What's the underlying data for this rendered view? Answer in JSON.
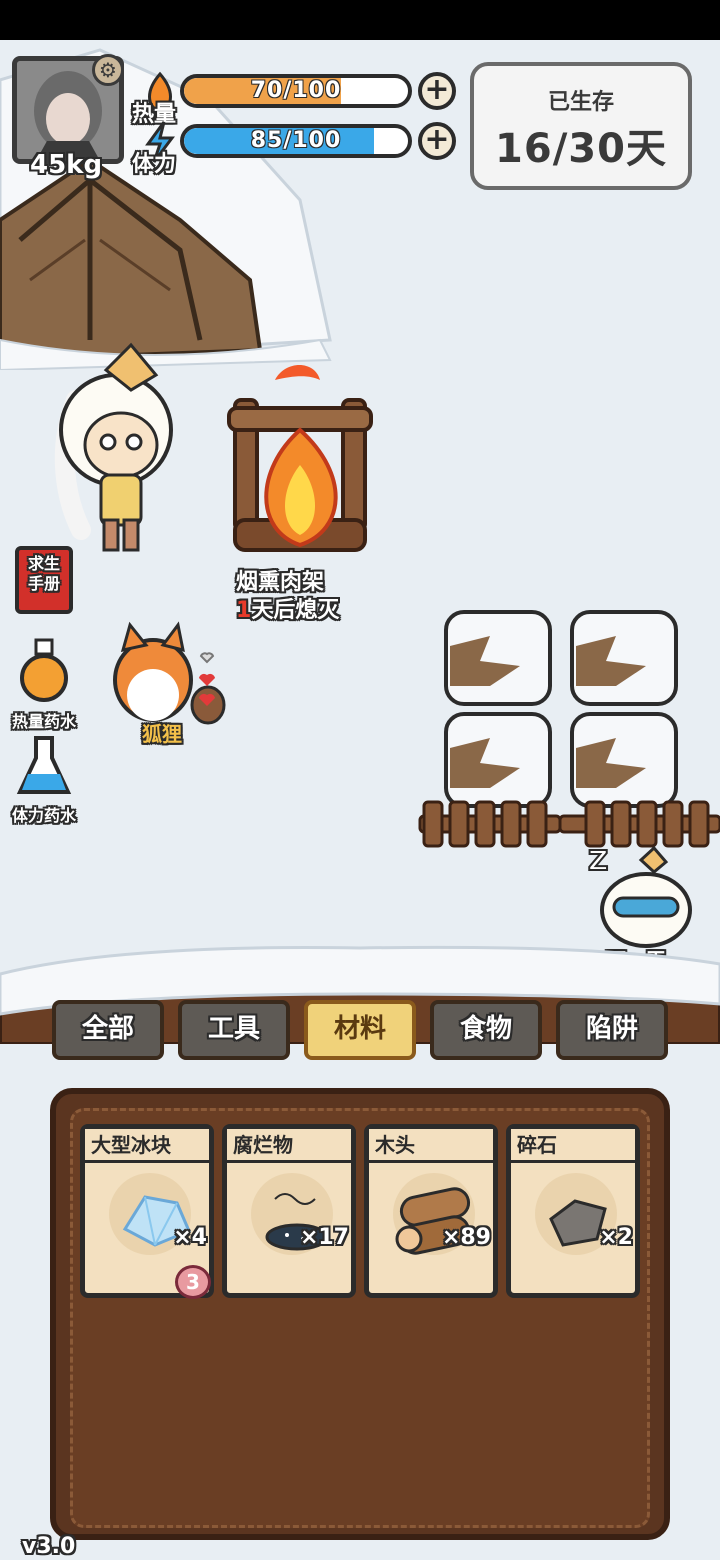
{
  "hud": {
    "weight": "45kg",
    "heat": {
      "label": "热量",
      "value": "70/100",
      "ratio": 0.7,
      "color": "#f0a24a"
    },
    "stamina": {
      "label": "体力",
      "value": "85/100",
      "ratio": 0.85,
      "color": "#3aa8e8"
    },
    "survived": {
      "label": "已生存",
      "value": "16/30天"
    }
  },
  "side": {
    "handbook": "求生\n手册",
    "handbook_line1": "求生",
    "handbook_line2": "手册",
    "heat_potion": "热量药水",
    "stamina_potion": "体力药水"
  },
  "world": {
    "campfire_name": "烟熏肉架",
    "campfire_days": "1",
    "campfire_status": "天后熄灭",
    "pet_name": "狐狸",
    "next_day": "下一天",
    "sleep_mark": "ZZZ"
  },
  "tabs": [
    {
      "label": "全部",
      "active": false
    },
    {
      "label": "工具",
      "active": false
    },
    {
      "label": "材料",
      "active": true
    },
    {
      "label": "食物",
      "active": false
    },
    {
      "label": "陷阱",
      "active": false
    }
  ],
  "inventory": [
    {
      "name": "大型冰块",
      "count": "×4",
      "badge": "3",
      "icon": "ice-block-icon"
    },
    {
      "name": "腐烂物",
      "count": "×17",
      "badge": "",
      "icon": "rotten-food-icon"
    },
    {
      "name": "木头",
      "count": "×89",
      "badge": "",
      "icon": "wood-log-icon"
    },
    {
      "name": "碎石",
      "count": "×2",
      "badge": "",
      "icon": "stone-icon"
    }
  ],
  "version": "v3.0",
  "colors": {
    "panel": "#5b3520",
    "active_tab": "#f0d27a",
    "snow": "#e8eef3"
  }
}
